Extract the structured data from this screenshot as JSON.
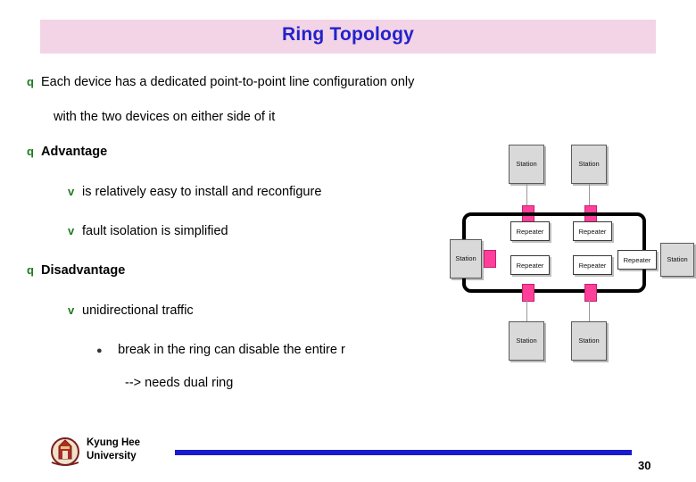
{
  "slide": {
    "title": "Ring Topology",
    "page_number": "30",
    "footer": {
      "line1": "Kyung Hee",
      "line2": "University"
    },
    "bullets": [
      {
        "level": 1,
        "marker": "q",
        "text": "Each device has a dedicated point-to-point line configuration only",
        "bold": false
      },
      {
        "level": 0,
        "marker": "",
        "text": "with the two devices on either side of it",
        "bold": false
      },
      {
        "level": 1,
        "marker": "q",
        "text": "Advantage",
        "bold": true
      },
      {
        "level": 2,
        "marker": "v",
        "text": "is relatively easy to install and reconfigure",
        "bold": false
      },
      {
        "level": 2,
        "marker": "v",
        "text": "fault isolation is simplified",
        "bold": false
      },
      {
        "level": 1,
        "marker": "q",
        "text": "Disadvantage",
        "bold": true
      },
      {
        "level": 2,
        "marker": "v",
        "text": "unidirectional traffic",
        "bold": false
      },
      {
        "level": 3,
        "marker": "l",
        "text": "break in the ring can disable the entire r",
        "bold": false
      },
      {
        "level": 0,
        "marker": "",
        "text": "--> needs dual ring",
        "bold": false
      }
    ]
  },
  "diagram": {
    "name": "ring-topology-diagram",
    "stations": [
      {
        "label": "Station"
      },
      {
        "label": "Station"
      },
      {
        "label": "Station"
      },
      {
        "label": "Station"
      },
      {
        "label": "Station"
      },
      {
        "label": "Station"
      }
    ],
    "repeaters": [
      {
        "label": "Repeater"
      },
      {
        "label": "Repeater"
      },
      {
        "label": "Repeater"
      },
      {
        "label": "Repeater"
      },
      {
        "label": "Repeater"
      }
    ],
    "colors": {
      "ring_line": "#000000",
      "connector": "#ff3f9a",
      "station_fill": "#d9d9d9",
      "repeater_fill": "#ffffff"
    }
  },
  "theme": {
    "title_band": "#f3d4e6",
    "title_color": "#2222cc",
    "marker_color": "#1f7a1f",
    "footer_rule": "#1a1ad0"
  }
}
